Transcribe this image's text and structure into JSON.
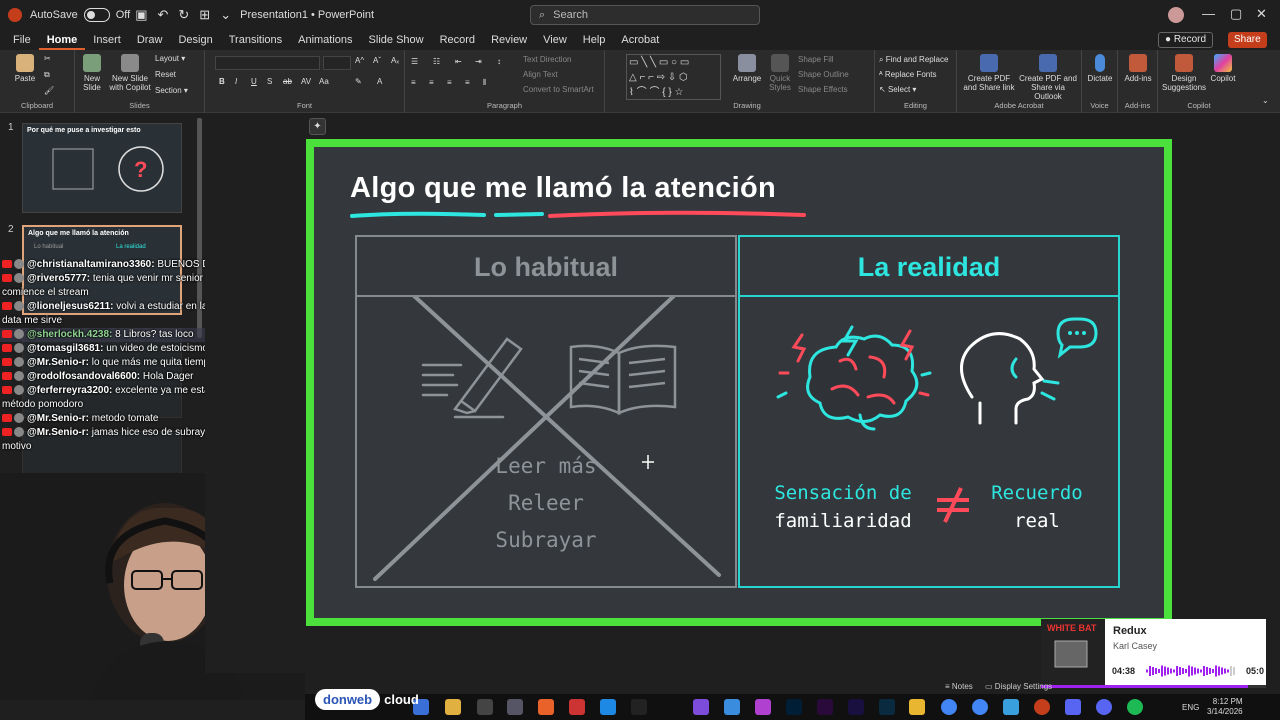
{
  "titlebar": {
    "autosave_label": "AutoSave",
    "autosave_state": "Off",
    "doc_title": "Presentation1",
    "app_name": "PowerPoint",
    "separator": "•",
    "search_placeholder": "Search"
  },
  "menu": {
    "items": [
      "File",
      "Home",
      "Insert",
      "Draw",
      "Design",
      "Transitions",
      "Animations",
      "Slide Show",
      "Record",
      "Review",
      "View",
      "Help",
      "Acrobat"
    ],
    "active": "Home",
    "record_label": "Record",
    "share_label": "Share"
  },
  "ribbon": {
    "clipboard": {
      "paste": "Paste",
      "label": "Clipboard"
    },
    "slides": {
      "new_slide": "New Slide",
      "new_slide_copilot": "New Slide with Copilot",
      "layout": "Layout",
      "reset": "Reset",
      "section": "Section",
      "label": "Slides"
    },
    "font": {
      "label": "Font"
    },
    "paragraph": {
      "text_direction": "Text Direction",
      "align_text": "Align Text",
      "smartart": "Convert to SmartArt",
      "label": "Paragraph"
    },
    "drawing": {
      "arrange": "Arrange",
      "quick_styles": "Quick Styles",
      "shape_fill": "Shape Fill",
      "shape_outline": "Shape Outline",
      "shape_effects": "Shape Effects",
      "label": "Drawing"
    },
    "editing": {
      "find_replace": "Find and Replace",
      "replace_fonts": "Replace Fonts",
      "select": "Select",
      "label": "Editing"
    },
    "acrobat": {
      "create_pdf_share": "Create PDF and Share link",
      "create_pdf_outlook": "Create PDF and Share via Outlook",
      "label": "Adobe Acrobat"
    },
    "voice": {
      "dictate": "Dictate",
      "label": "Voice"
    },
    "addins": {
      "addins": "Add-ins",
      "label": "Add-ins"
    },
    "designer": {
      "design_suggestions": "Design Suggestions",
      "copilot": "Copilot",
      "label": "Copilot"
    }
  },
  "thumbnails": [
    {
      "num": "1",
      "title": "Por qué me puse a investigar esto"
    },
    {
      "num": "2",
      "title": "Algo que me llamó la atención",
      "col_left": "Lo habitual",
      "col_right": "La realidad"
    }
  ],
  "chat": [
    {
      "user": "@christianaltamirano3360:",
      "msg": "BUENOS DIAS"
    },
    {
      "user": "@rivero5777:",
      "msg": "tenia que venir mr senior para que realmente comience el stream"
    },
    {
      "user": "@lioneljesus6211:",
      "msg": "volvi a estudiar en la facultad asi que esta data me sirve"
    },
    {
      "user": "@sherlockh.4238:",
      "msg": "8 Libros? tas loco"
    },
    {
      "user": "@tomasgil3681:",
      "msg": "un video de estoicismo omg"
    },
    {
      "user": "@Mr.Senio-r:",
      "msg": "lo que más me quita tiempo es cocinar"
    },
    {
      "user": "@rodolfosandoval6600:",
      "msg": "Hola Dager"
    },
    {
      "user": "@ferferreyra3200:",
      "msg": "excelente ya me estaba cansando del método pomodoro"
    },
    {
      "user": "@Mr.Senio-r:",
      "msg": "metodo tomate"
    },
    {
      "user": "@Mr.Senio-r:",
      "msg": "jamas hice eso de subrayar/resaltar, por x o y motivo"
    }
  ],
  "slide": {
    "title": "Algo que me llamó la atención",
    "left_head": "Lo habitual",
    "left_items": [
      "Leer más",
      "Releer",
      "Subrayar"
    ],
    "right_head": "La realidad",
    "sensation_line1": "Sensación de",
    "sensation_line2": "familiaridad",
    "recuerdo_line1": "Recuerdo",
    "recuerdo_line2": "real",
    "colors": {
      "border": "#4ce03c",
      "accent": "#2ee6e0",
      "red": "#ff4a5a",
      "gray": "#8e9398"
    }
  },
  "music": {
    "title": "Redux",
    "artist": "Karl Casey",
    "time_elapsed": "04:38",
    "time_total": "05:0",
    "progress": 0.92
  },
  "statusbar": {
    "notes": "Notes",
    "display_settings": "Display Settings"
  },
  "taskbar": {
    "donweb": "donweb",
    "cloud": "cloud",
    "lang": "ENG",
    "time": "8:12 PM",
    "date": "3/14/2026"
  }
}
